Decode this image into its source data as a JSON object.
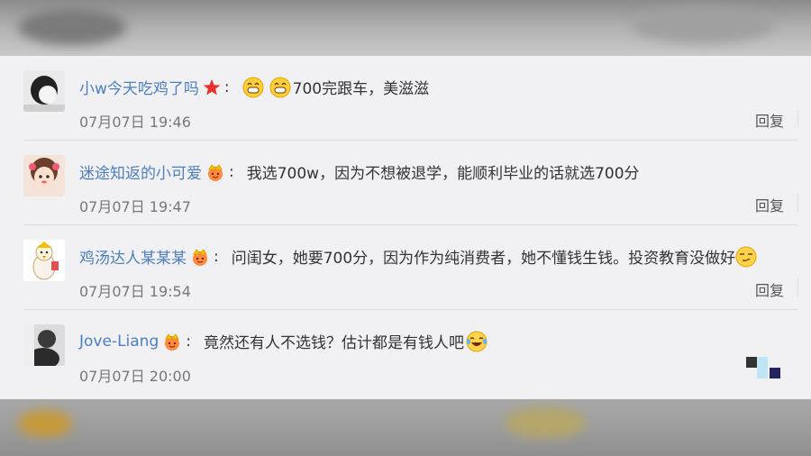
{
  "comments": [
    {
      "username": "小w今天吃鸡了吗",
      "badge_icon": "red-star-icon",
      "separator": ":",
      "text": "700完跟车，美滋滋",
      "emoji_prefix": [
        "grin-icon",
        "grin-icon"
      ],
      "time": "07月07日 19:46",
      "reply_label": "回复"
    },
    {
      "username": "迷途知返的小可爱",
      "badge_icon": "crown-icon",
      "separator": ":",
      "text": "我选700w，因为不想被退学，能顺利毕业的话就选700分",
      "time": "07月07日 19:47",
      "reply_label": "回复"
    },
    {
      "username": "鸡汤达人某某某",
      "badge_icon": "crown-icon",
      "separator": ":",
      "text": "问闺女，她要700分，因为作为纯消费者，她不懂钱生钱。投资教育没做好",
      "emoji_suffix": "smirk-icon",
      "time": "07月07日 19:54",
      "reply_label": "回复"
    },
    {
      "username": "Jove-Liang",
      "badge_icon": "crown-icon",
      "separator": ":",
      "text": "竟然还有人不选钱？估计都是有钱人吧",
      "emoji_suffix": "laugh-tears-icon",
      "time": "07月07日 20:00"
    }
  ],
  "colors": {
    "username": "#4d7fbf",
    "panel_bg": "#f1f1f4",
    "time": "#777777"
  }
}
